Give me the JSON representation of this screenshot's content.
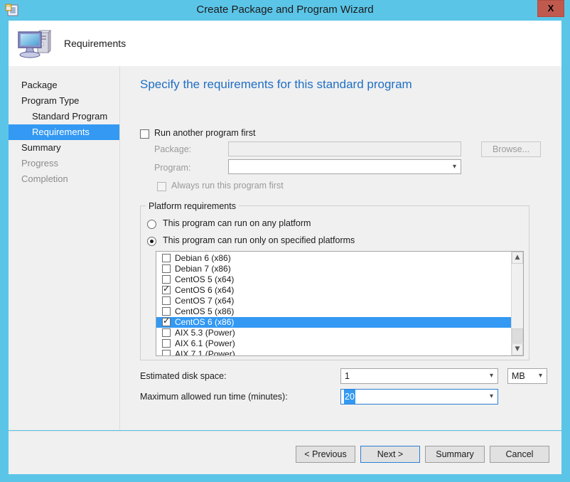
{
  "window": {
    "title": "Create Package and Program Wizard",
    "close_label": "X",
    "icon": "package-wizard-icon"
  },
  "header": {
    "title": "Requirements",
    "icon": "computer-monitor-icon"
  },
  "sidebar": {
    "items": [
      {
        "label": "Package",
        "indent": false,
        "state": "normal"
      },
      {
        "label": "Program Type",
        "indent": false,
        "state": "normal"
      },
      {
        "label": "Standard Program",
        "indent": true,
        "state": "normal"
      },
      {
        "label": "Requirements",
        "indent": true,
        "state": "selected"
      },
      {
        "label": "Summary",
        "indent": false,
        "state": "normal"
      },
      {
        "label": "Progress",
        "indent": false,
        "state": "disabled"
      },
      {
        "label": "Completion",
        "indent": false,
        "state": "disabled"
      }
    ]
  },
  "content": {
    "heading": "Specify the requirements for this standard program",
    "run_another": {
      "label": "Run another program first",
      "checked": false,
      "package_label": "Package:",
      "package_value": "",
      "program_label": "Program:",
      "program_value": "",
      "browse_label": "Browse...",
      "always_run_label": "Always run this program first",
      "always_run_checked": false
    },
    "platform_group": {
      "title": "Platform requirements",
      "radio_any": "This program can run on any platform",
      "radio_specified": "This program can run only on specified platforms",
      "selected_radio": "specified",
      "platforms": [
        {
          "label": "Debian 6 (x86)",
          "checked": false,
          "selected": false
        },
        {
          "label": "Debian 7 (x86)",
          "checked": false,
          "selected": false
        },
        {
          "label": "CentOS 5 (x64)",
          "checked": false,
          "selected": false
        },
        {
          "label": "CentOS 6 (x64)",
          "checked": true,
          "selected": false
        },
        {
          "label": "CentOS 7 (x64)",
          "checked": false,
          "selected": false
        },
        {
          "label": "CentOS 5 (x86)",
          "checked": false,
          "selected": false
        },
        {
          "label": "CentOS 6 (x86)",
          "checked": true,
          "selected": true
        },
        {
          "label": "AIX 5.3 (Power)",
          "checked": false,
          "selected": false
        },
        {
          "label": "AIX 6.1 (Power)",
          "checked": false,
          "selected": false
        },
        {
          "label": "AIX 7.1 (Power)",
          "checked": false,
          "selected": false
        }
      ]
    },
    "disk_space": {
      "label": "Estimated disk space:",
      "value": "1",
      "unit": "MB"
    },
    "run_time": {
      "label": "Maximum allowed run time (minutes):",
      "value": "20",
      "selected_text": true
    }
  },
  "footer": {
    "buttons": [
      {
        "label": "< Previous",
        "focused": false
      },
      {
        "label": "Next >",
        "focused": true
      },
      {
        "label": "Summary",
        "focused": false
      },
      {
        "label": "Cancel",
        "focused": false
      }
    ]
  },
  "colors": {
    "title_bar": "#5bc5e8",
    "accent_blue": "#3399f3",
    "heading_blue": "#1f6fc4",
    "close_red": "#c05a4e",
    "panel_grey": "#f0f0f0"
  }
}
